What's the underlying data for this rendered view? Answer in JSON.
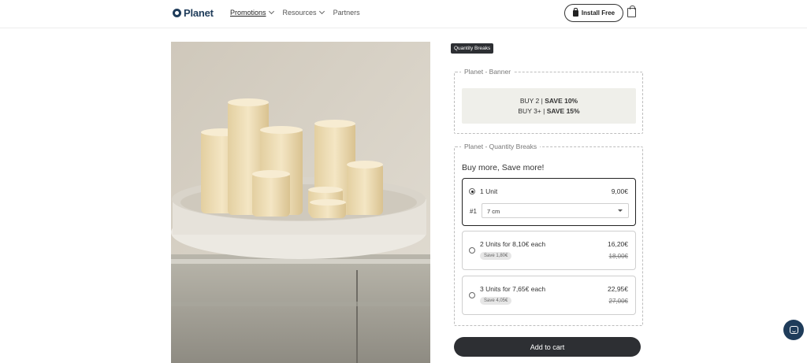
{
  "header": {
    "logo_text": "Planet",
    "nav": [
      {
        "label": "Promotions",
        "has_dropdown": true,
        "active": true
      },
      {
        "label": "Resources",
        "has_dropdown": true,
        "active": false
      },
      {
        "label": "Partners",
        "has_dropdown": false,
        "active": false
      }
    ],
    "install_label": "Install Free",
    "icons": {
      "install": "shopping-bag-icon",
      "cart": "cart-icon"
    }
  },
  "product_image": {
    "icon": "product-photo"
  },
  "quantity_breaks_tag": "Quantity Breaks",
  "banner": {
    "legend": "Planet - Banner",
    "line1_prefix": "BUY 2 | ",
    "line1_bold": "SAVE 10%",
    "line2_prefix": "BUY 3+ | ",
    "line2_bold": "SAVE 15%"
  },
  "quantity_breaks": {
    "legend": "Planet - Quantity Breaks",
    "heading": "Buy more, Save more!",
    "options": [
      {
        "title": "1 Unit",
        "price": "9,00€",
        "selected": true,
        "variant_index": "#1",
        "variant_value": "7 cm"
      },
      {
        "title": "2 Units for 8,10€ each",
        "price": "16,20€",
        "compare_price": "18,00€",
        "save_badge": "Save 1,80€",
        "selected": false
      },
      {
        "title": "3 Units for 7,65€ each",
        "price": "22,95€",
        "compare_price": "27,00€",
        "save_badge": "Save 4,05€",
        "selected": false
      }
    ]
  },
  "add_to_cart_label": "Add to cart",
  "chat": {
    "icon": "chat-icon"
  },
  "colors": {
    "brand": "#1f3c5a",
    "dark_button": "#2d2f33",
    "banner_bg": "#efefea"
  }
}
